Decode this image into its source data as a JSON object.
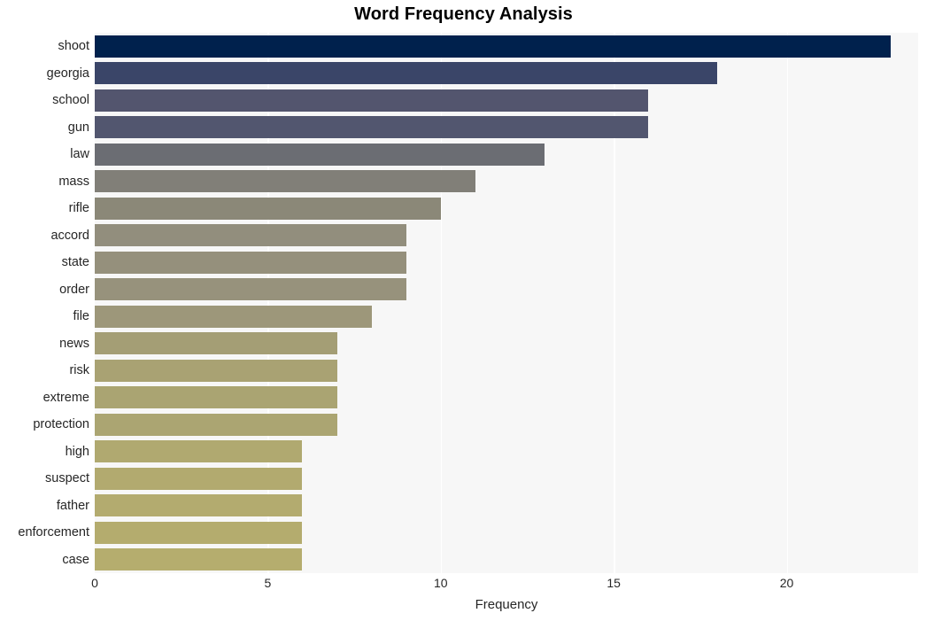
{
  "chart_data": {
    "type": "bar",
    "orientation": "horizontal",
    "title": "Word Frequency Analysis",
    "xlabel": "Frequency",
    "ylabel": "",
    "xlim": [
      0,
      23.8
    ],
    "ylim": null,
    "grid": "vertical-only",
    "legend": "none",
    "xticks": [
      0,
      5,
      10,
      15,
      20
    ],
    "xtick_labels": [
      "0",
      "5",
      "10",
      "15",
      "20"
    ],
    "categories": [
      "shoot",
      "georgia",
      "school",
      "gun",
      "law",
      "mass",
      "rifle",
      "accord",
      "state",
      "order",
      "file",
      "news",
      "risk",
      "extreme",
      "protection",
      "high",
      "suspect",
      "father",
      "enforcement",
      "case"
    ],
    "values": [
      23,
      18,
      16,
      16,
      13,
      11,
      10,
      9,
      9,
      9,
      8,
      7,
      7,
      7,
      7,
      6,
      6,
      6,
      6,
      6
    ],
    "bar_colors": [
      "#00214d",
      "#3a4568",
      "#53556e",
      "#52566f",
      "#6b6d73",
      "#817f78",
      "#8b8878",
      "#928e7d",
      "#95907c",
      "#97927c",
      "#9d977a",
      "#a49e75",
      "#a9a273",
      "#aaa472",
      "#aba572",
      "#b0a970",
      "#b2aa6f",
      "#b3ab6f",
      "#b4ac6e",
      "#b5ad6e"
    ],
    "plot_background": "#f7f7f7",
    "gridline_color": "#ffffff",
    "figure_background": "#ffffff",
    "text_color": "#262626"
  }
}
